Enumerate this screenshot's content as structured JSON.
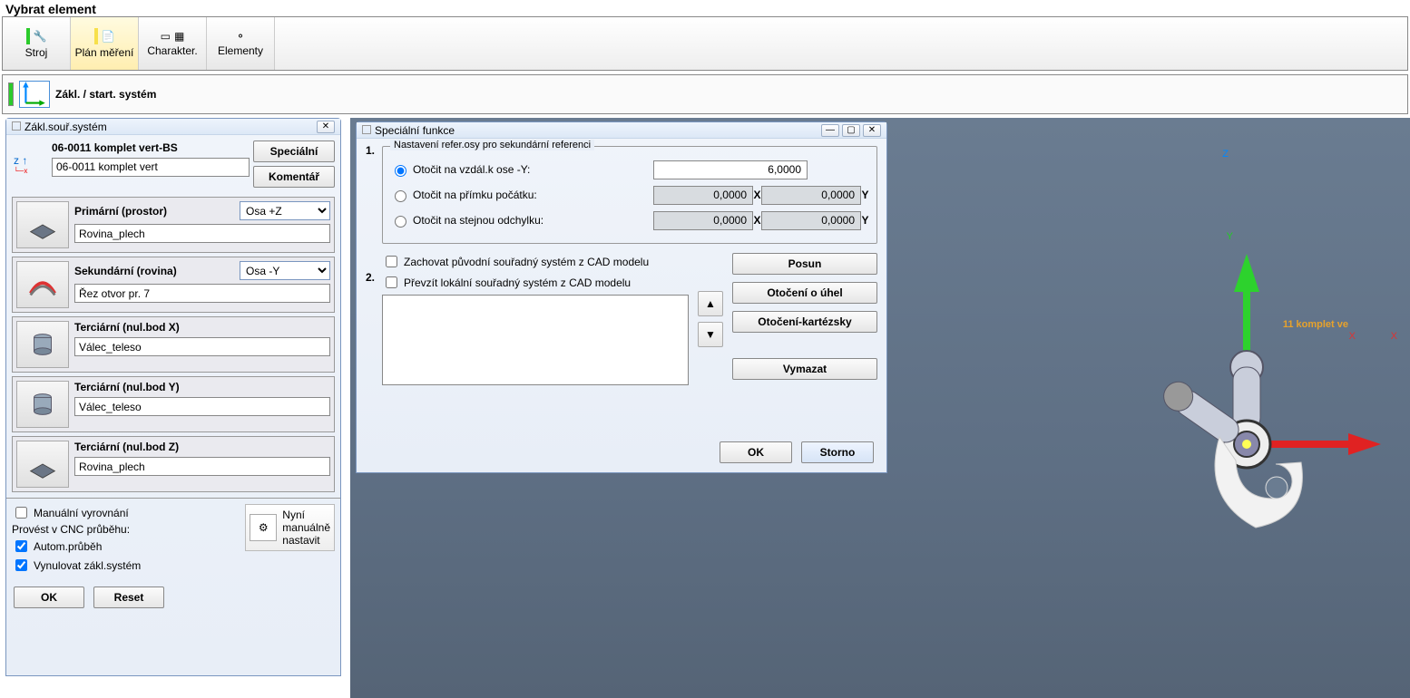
{
  "top_title": "Vybrat element",
  "toolbar": {
    "stroj": "Stroj",
    "plan": "Plán měření",
    "charakter": "Charakter.",
    "elementy": "Elementy"
  },
  "status": {
    "label": "Zákl. / start. systém"
  },
  "left_panel": {
    "title": "Zákl.souř.systém",
    "name1": "06-0011 komplet vert-BS",
    "name2": "06-0011 komplet vert",
    "btn_special": "Speciální",
    "btn_comment": "Komentář",
    "primary": {
      "label": "Primární (prostor)",
      "axis": "Osa +Z",
      "value": "Rovina_plech"
    },
    "secondary": {
      "label": "Sekundární (rovina)",
      "axis": "Osa -Y",
      "value": "Řez otvor pr. 7"
    },
    "tert_x": {
      "label": "Terciární (nul.bod X)",
      "value": "Válec_teleso"
    },
    "tert_y": {
      "label": "Terciární (nul.bod Y)",
      "value": "Válec_teleso"
    },
    "tert_z": {
      "label": "Terciární (nul.bod Z)",
      "value": "Rovina_plech"
    },
    "opts": {
      "manual": "Manuální vyrovnání",
      "provest": "Provést v CNC průběhu:",
      "autom": "Autom.průběh",
      "vynul": "Vynulovat zákl.systém",
      "nyni": "Nyní\nmanuálně\nnastavit"
    },
    "ok": "OK",
    "reset": "Reset"
  },
  "dialog": {
    "title": "Speciální funkce",
    "step1": "1.",
    "group1_legend": "Nastavení refer.osy pro sekundární referenci",
    "r1": "Otočit na vzdál.k ose -Y:",
    "r1_val": "6,0000",
    "r2": "Otočit na přímku počátku:",
    "r2_x": "0,0000",
    "r2_y": "0,0000",
    "r3": "Otočit na stejnou odchylku:",
    "r3_x": "0,0000",
    "r3_y": "0,0000",
    "ax_x": "X",
    "ax_y": "Y",
    "step2": "2.",
    "chk1": "Zachovat původní souřadný systém z CAD modelu",
    "chk2": "Převzít lokální souřadný systém z CAD modelu",
    "btn_posun": "Posun",
    "btn_otoc_uhel": "Otočení o úhel",
    "btn_otoc_kart": "Otočení-kartézsky",
    "btn_vymazat": "Vymazat",
    "ok": "OK",
    "storno": "Storno"
  },
  "viewport": {
    "x": "X",
    "y": "Y",
    "z": "Z",
    "part_label": "11 komplet ve"
  }
}
